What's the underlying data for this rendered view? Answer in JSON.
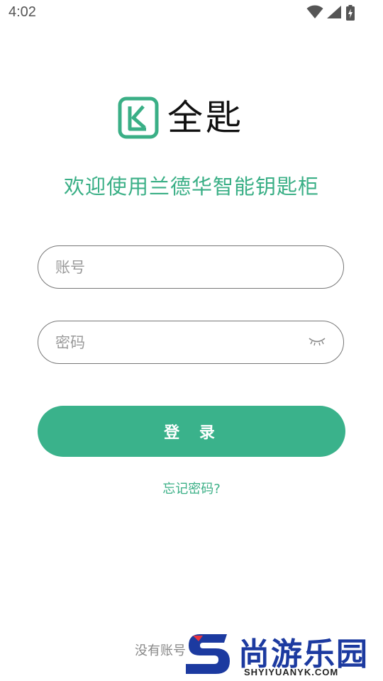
{
  "status_bar": {
    "time": "4:02"
  },
  "brand": {
    "name": "全匙",
    "color": "#3aaf86"
  },
  "welcome": {
    "text": "欢迎使用兰德华智能钥匙柜"
  },
  "form": {
    "account_placeholder": "账号",
    "password_placeholder": "密码",
    "login_label": "登 录",
    "forgot_label": "忘记密码?"
  },
  "footer": {
    "register_prompt": "没有账号"
  },
  "watermark": {
    "title": "尚游乐园",
    "domain": "SHYIYUANYK.COM"
  },
  "icons": {
    "wifi": "wifi-icon",
    "signal": "signal-icon",
    "battery": "battery-icon",
    "password_toggle": "eye-closed-icon"
  }
}
